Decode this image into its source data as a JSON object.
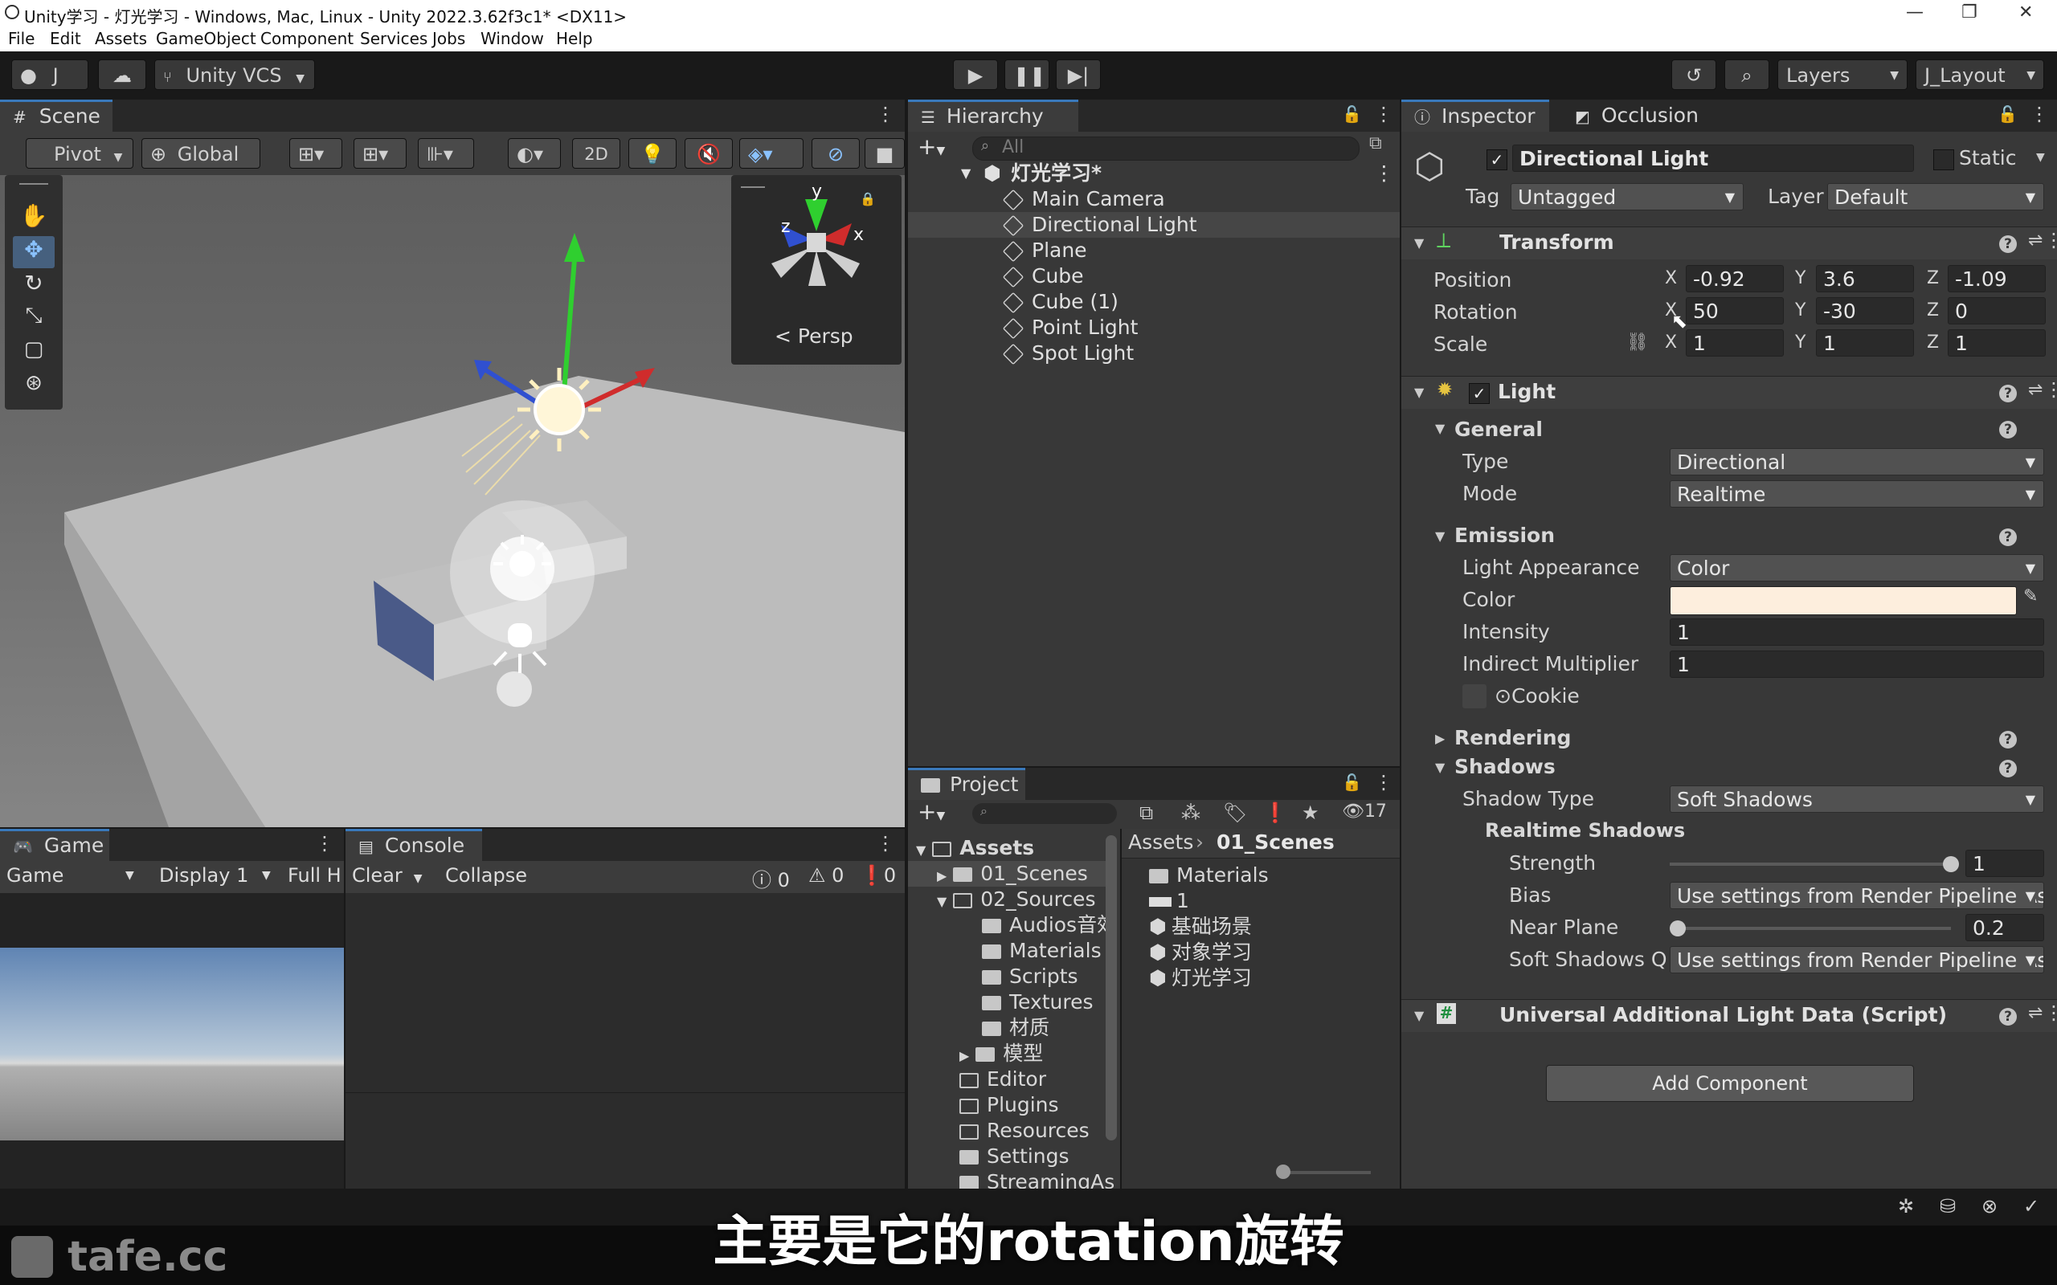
{
  "window": {
    "title": "Unity学习 - 灯光学习 - Windows, Mac, Linux - Unity 2022.3.62f3c1* <DX11>",
    "controls": [
      "—",
      "❐",
      "✕"
    ]
  },
  "menu": [
    "File",
    "Edit",
    "Assets",
    "GameObject",
    "Component",
    "Services",
    "Jobs",
    "Window",
    "Help"
  ],
  "toolbar": {
    "account": "J",
    "vcs": "Unity VCS",
    "layers": "Layers",
    "layout": "J_Layout"
  },
  "scene": {
    "tab": "Scene",
    "pivot": "Pivot",
    "global": "Global",
    "mode2d": "2D",
    "persp": "< Persp",
    "gizmo": {
      "y": "y",
      "x": "x",
      "z": "z"
    }
  },
  "game": {
    "tab": "Game",
    "mode": "Game",
    "display": "Display 1",
    "res": "Full H"
  },
  "console": {
    "tab": "Console",
    "clear": "Clear",
    "collapse": "Collapse",
    "counts": [
      "0",
      "0",
      "0"
    ]
  },
  "hierarchy": {
    "tab": "Hierarchy",
    "search": "All",
    "scene_name": "灯光学习*",
    "items": [
      "Main Camera",
      "Directional Light",
      "Plane",
      "Cube",
      "Cube (1)",
      "Point Light",
      "Spot Light"
    ]
  },
  "project": {
    "tab": "Project",
    "count": "17",
    "tree": [
      {
        "label": "Assets",
        "bold": true
      },
      {
        "label": "01_Scenes"
      },
      {
        "label": "02_Sources"
      },
      {
        "label": "Audios音效"
      },
      {
        "label": "Materials"
      },
      {
        "label": "Scripts"
      },
      {
        "label": "Textures"
      },
      {
        "label": "材质"
      },
      {
        "label": "模型"
      },
      {
        "label": "Editor"
      },
      {
        "label": "Plugins"
      },
      {
        "label": "Resources"
      },
      {
        "label": "Settings"
      },
      {
        "label": "StreamingAs"
      }
    ],
    "breadcrumb": [
      "Assets",
      "01_Scenes"
    ],
    "files": [
      "Materials",
      "1",
      "基础场景",
      "对象学习",
      "灯光学习"
    ]
  },
  "inspector": {
    "tab": "Inspector",
    "tab2": "Occlusion",
    "object_name": "Directional Light",
    "static": "Static",
    "tag_label": "Tag",
    "tag": "Untagged",
    "layer_label": "Layer",
    "layer": "Default",
    "transform": {
      "title": "Transform",
      "position_label": "Position",
      "rotation_label": "Rotation",
      "scale_label": "Scale",
      "position": {
        "x": "-0.92",
        "y": "3.6",
        "z": "-1.09"
      },
      "rotation": {
        "x": "50",
        "y": "-30",
        "z": "0"
      },
      "scale": {
        "x": "1",
        "y": "1",
        "z": "1"
      },
      "axes": [
        "X",
        "Y",
        "Z"
      ]
    },
    "light": {
      "title": "Light",
      "general": "General",
      "type_label": "Type",
      "type": "Directional",
      "mode_label": "Mode",
      "mode": "Realtime",
      "emission": "Emission",
      "appearance_label": "Light Appearance",
      "appearance": "Color",
      "color_label": "Color",
      "color": "#fdeedd",
      "intensity_label": "Intensity",
      "intensity": "1",
      "indirect_label": "Indirect Multiplier",
      "indirect": "1",
      "cookie": "⊙Cookie",
      "rendering": "Rendering",
      "shadows": "Shadows",
      "shadow_type_label": "Shadow Type",
      "shadow_type": "Soft Shadows",
      "realtime_shadows": "Realtime Shadows",
      "strength_label": "Strength",
      "strength": "1",
      "strength_level": 1.0,
      "bias_label": "Bias",
      "bias": "Use settings from Render Pipeline Asset",
      "near_plane_label": "Near Plane",
      "near_plane": "0.2",
      "near_plane_level": 0.0,
      "soft_quality_label": "Soft Shadows Qu",
      "soft_quality": "Use settings from Render Pipeline Asset"
    },
    "urp": {
      "title": "Universal Additional Light Data (Script)"
    },
    "add_component": "Add Component"
  },
  "subtitle": "主要是它的rotation旋转",
  "watermark": "tafe.cc"
}
